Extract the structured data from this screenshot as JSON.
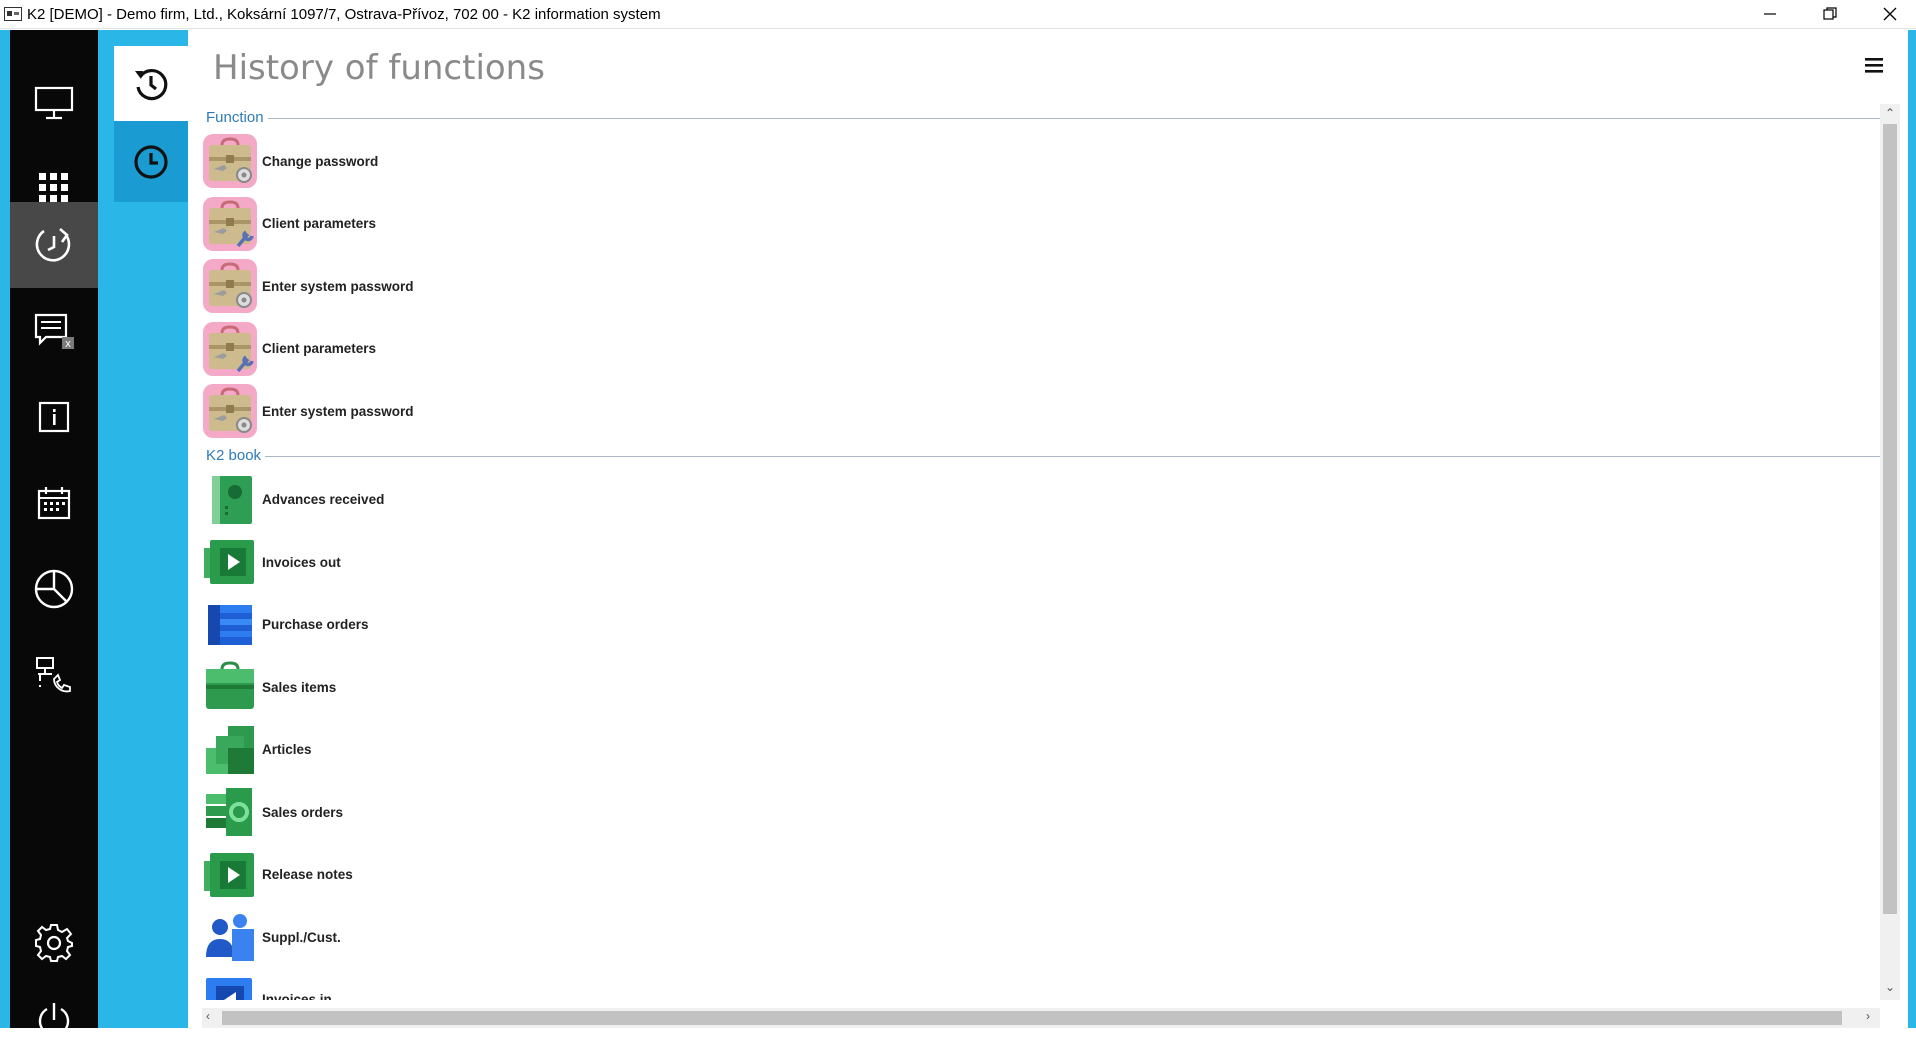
{
  "window": {
    "title": "K2 [DEMO] - Demo firm, Ltd., Koksární 1097/7, Ostrava-Přívoz, 702 00 - K2 information system",
    "controls": [
      "minimize-icon",
      "restore-icon",
      "close-icon"
    ]
  },
  "rail": {
    "items": [
      {
        "name": "monitor-icon",
        "active": false
      },
      {
        "name": "apps-grid-icon",
        "active": false
      },
      {
        "name": "history-icon",
        "active": true
      },
      {
        "name": "messages-icon",
        "active": false
      },
      {
        "name": "info-icon",
        "active": false
      },
      {
        "name": "calendar-icon",
        "active": false
      },
      {
        "name": "pie-chart-icon",
        "active": false
      },
      {
        "name": "network-phone-icon",
        "active": false
      },
      {
        "name": "gear-icon",
        "active": false
      },
      {
        "name": "power-icon",
        "active": false
      }
    ],
    "messages_badge": "x"
  },
  "page": {
    "title": "History of functions"
  },
  "groups": [
    {
      "label": "Function",
      "items": [
        {
          "label": "Change password",
          "icon": "toolbox-gear-icon"
        },
        {
          "label": "Client parameters",
          "icon": "toolbox-wrench-icon"
        },
        {
          "label": "Enter system password",
          "icon": "toolbox-gear-icon"
        },
        {
          "label": "Client parameters",
          "icon": "toolbox-wrench-icon"
        },
        {
          "label": "Enter system password",
          "icon": "toolbox-gear-icon"
        }
      ]
    },
    {
      "label": "K2 book",
      "items": [
        {
          "label": "Advances received",
          "icon": "advances-book-icon"
        },
        {
          "label": "Invoices out",
          "icon": "invoices-out-icon"
        },
        {
          "label": "Purchase orders",
          "icon": "purchase-orders-icon"
        },
        {
          "label": "Sales items",
          "icon": "sales-items-icon"
        },
        {
          "label": "Articles",
          "icon": "articles-icon"
        },
        {
          "label": "Sales orders",
          "icon": "sales-orders-icon"
        },
        {
          "label": "Release notes",
          "icon": "release-notes-icon"
        },
        {
          "label": "Suppl./Cust.",
          "icon": "suppliers-customers-icon"
        },
        {
          "label": "Invoices in",
          "icon": "invoices-in-icon"
        }
      ]
    }
  ],
  "colors": {
    "rail_bg": "#080808",
    "rail_active": "#484848",
    "accent": "#2bb6e8",
    "group_label": "#2b7bb9"
  }
}
